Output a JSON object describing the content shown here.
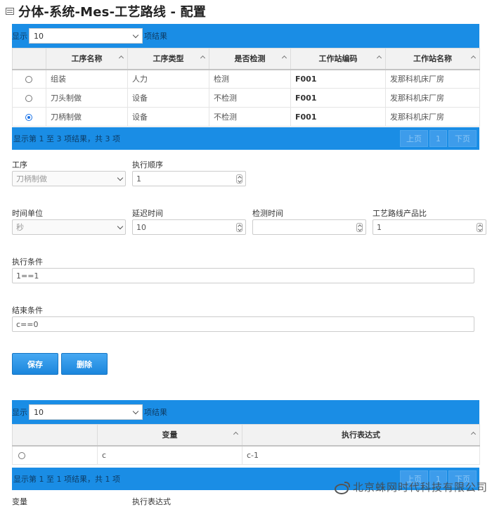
{
  "page": {
    "title": "分体-系统-Mes-工艺路线 - 配置"
  },
  "routes_table": {
    "length_prefix": "显示",
    "length_value": "10",
    "length_suffix": "项结果",
    "columns": [
      "工序名称",
      "工序类型",
      "是否检测",
      "工作站编码",
      "工作站名称"
    ],
    "rows": [
      {
        "selected": false,
        "cells": [
          "组装",
          "人力",
          "检测",
          "F001",
          "发那科机床厂房"
        ]
      },
      {
        "selected": false,
        "cells": [
          "刀头制做",
          "设备",
          "不检测",
          "F001",
          "发那科机床厂房"
        ]
      },
      {
        "selected": true,
        "cells": [
          "刀柄制做",
          "设备",
          "不检测",
          "F001",
          "发那科机床厂房"
        ]
      }
    ],
    "info": "显示第 1 至 3 项结果，共 3 项",
    "pager": {
      "prev": "上页",
      "page": "1",
      "next": "下页"
    }
  },
  "form": {
    "process_label": "工序",
    "process_value": "刀柄制做",
    "order_label": "执行顺序",
    "order_value": "1",
    "time_unit_label": "时间单位",
    "time_unit_value": "秒",
    "delay_label": "延迟时间",
    "delay_value": "10",
    "check_time_label": "检测时间",
    "check_time_value": "",
    "ratio_label": "工艺路线产品比",
    "ratio_value": "1",
    "exec_condition_label": "执行条件",
    "exec_condition_value": "1==1",
    "end_condition_label": "结束条件",
    "end_condition_value": "c==0",
    "save_label": "保存",
    "delete_label": "删除"
  },
  "vars_table": {
    "length_prefix": "显示",
    "length_value": "10",
    "length_suffix": "项结果",
    "columns": [
      "变量",
      "执行表达式"
    ],
    "rows": [
      {
        "selected": false,
        "cells": [
          "c",
          "c-1"
        ]
      }
    ],
    "info": "显示第 1 至 1 项结果，共 1 项",
    "pager": {
      "prev": "上页",
      "page": "1",
      "next": "下页"
    }
  },
  "partial_labels": {
    "left": "变量",
    "right": "执行表达式"
  },
  "watermark": {
    "text": "北京蛛网时代科技有限公司",
    "icon": "weibo-icon"
  },
  "colors": {
    "accent": "#1a8de5",
    "button": "#2a96e6"
  }
}
